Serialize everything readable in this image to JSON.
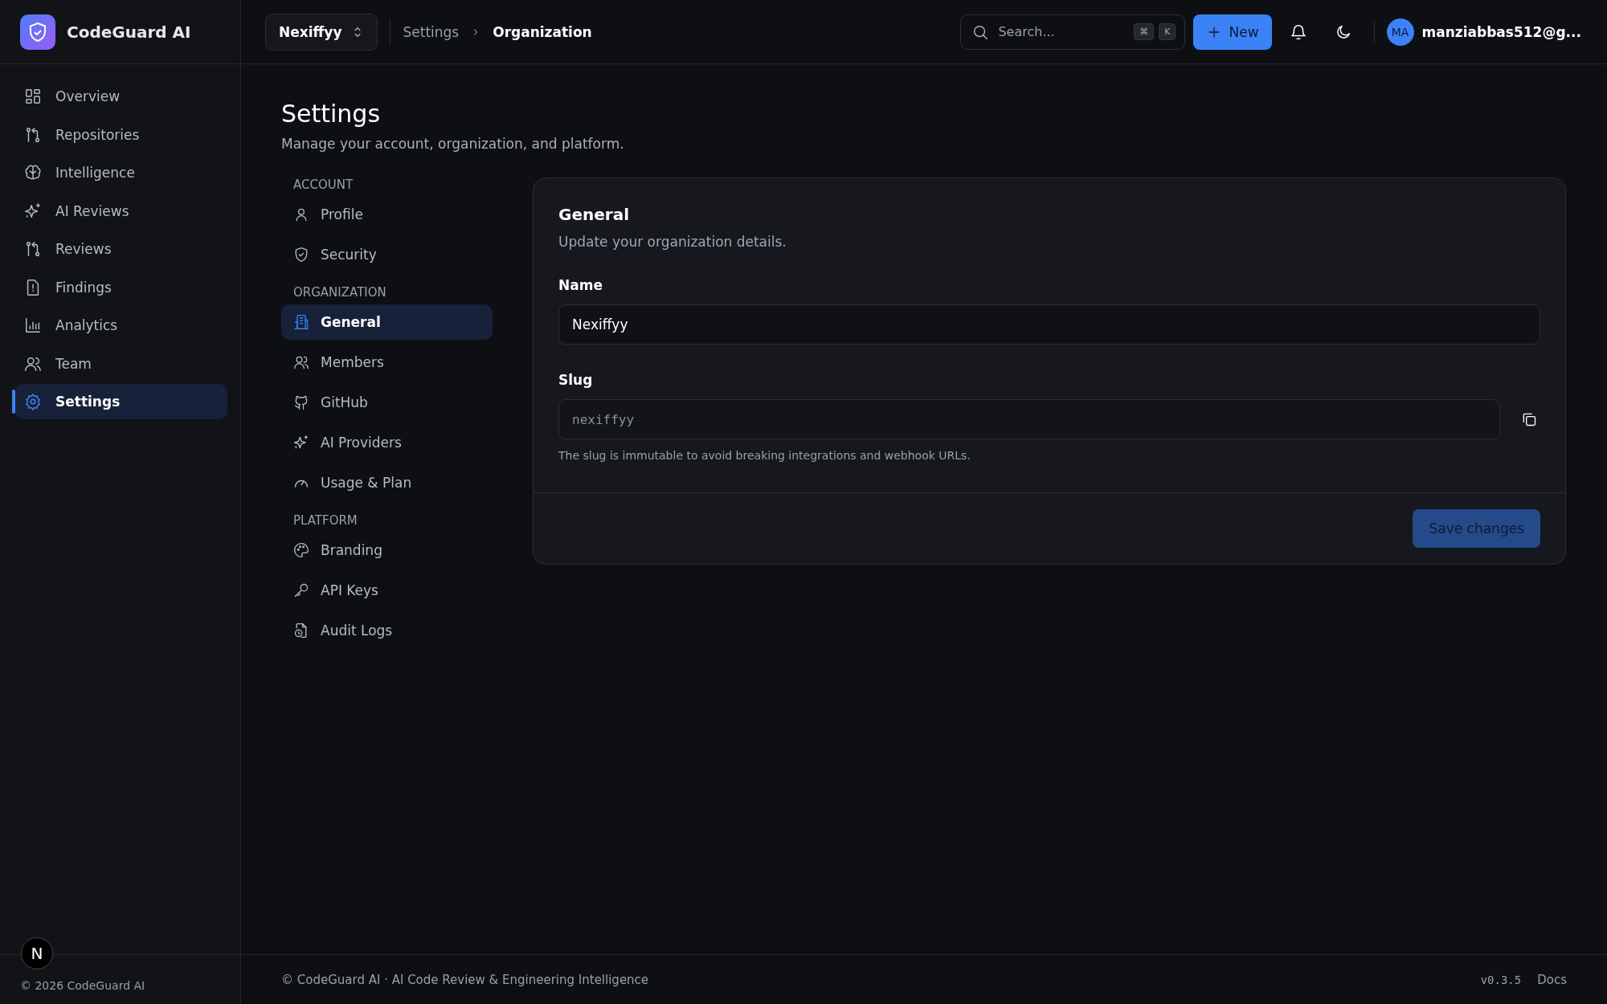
{
  "app": {
    "name": "CodeGuard AI"
  },
  "sidebar": {
    "items": [
      {
        "label": "Overview",
        "selected": false
      },
      {
        "label": "Repositories",
        "selected": false
      },
      {
        "label": "Intelligence",
        "selected": false
      },
      {
        "label": "AI Reviews",
        "selected": false
      },
      {
        "label": "Reviews",
        "selected": false
      },
      {
        "label": "Findings",
        "selected": false
      },
      {
        "label": "Analytics",
        "selected": false
      },
      {
        "label": "Team",
        "selected": false
      },
      {
        "label": "Settings",
        "selected": true
      }
    ],
    "badge": "N",
    "footer": "© 2026 CodeGuard AI"
  },
  "topbar": {
    "org_switcher": "Nexiffyy",
    "breadcrumb": [
      "Settings",
      "Organization"
    ],
    "search": {
      "placeholder": "Search...",
      "shortcut": [
        "⌘",
        "K"
      ]
    },
    "new_button": "New",
    "user": {
      "initials": "MA",
      "email": "manziabbas512@g..."
    }
  },
  "page": {
    "title": "Settings",
    "subtitle": "Manage your account, organization, and platform."
  },
  "settings_nav": [
    {
      "heading": "ACCOUNT",
      "items": [
        {
          "label": "Profile",
          "selected": false
        },
        {
          "label": "Security",
          "selected": false
        }
      ]
    },
    {
      "heading": "ORGANIZATION",
      "items": [
        {
          "label": "General",
          "selected": true
        },
        {
          "label": "Members",
          "selected": false
        },
        {
          "label": "GitHub",
          "selected": false
        },
        {
          "label": "AI Providers",
          "selected": false
        },
        {
          "label": "Usage & Plan",
          "selected": false
        }
      ]
    },
    {
      "heading": "PLATFORM",
      "items": [
        {
          "label": "Branding",
          "selected": false
        },
        {
          "label": "API Keys",
          "selected": false
        },
        {
          "label": "Audit Logs",
          "selected": false
        }
      ]
    }
  ],
  "card": {
    "title": "General",
    "subtitle": "Update your organization details.",
    "fields": [
      {
        "kind": "text",
        "label": "Name",
        "value": "Nexiffyy"
      },
      {
        "kind": "readonly",
        "label": "Slug",
        "value": "nexiffyy",
        "hint": "The slug is immutable to avoid breaking integrations and webhook URLs."
      }
    ],
    "save_button": {
      "label": "Save changes",
      "disabled": true
    }
  },
  "footer": {
    "text": "© CodeGuard AI · AI Code Review & Engineering Intelligence",
    "version": "v0.3.5",
    "link": "Docs"
  }
}
